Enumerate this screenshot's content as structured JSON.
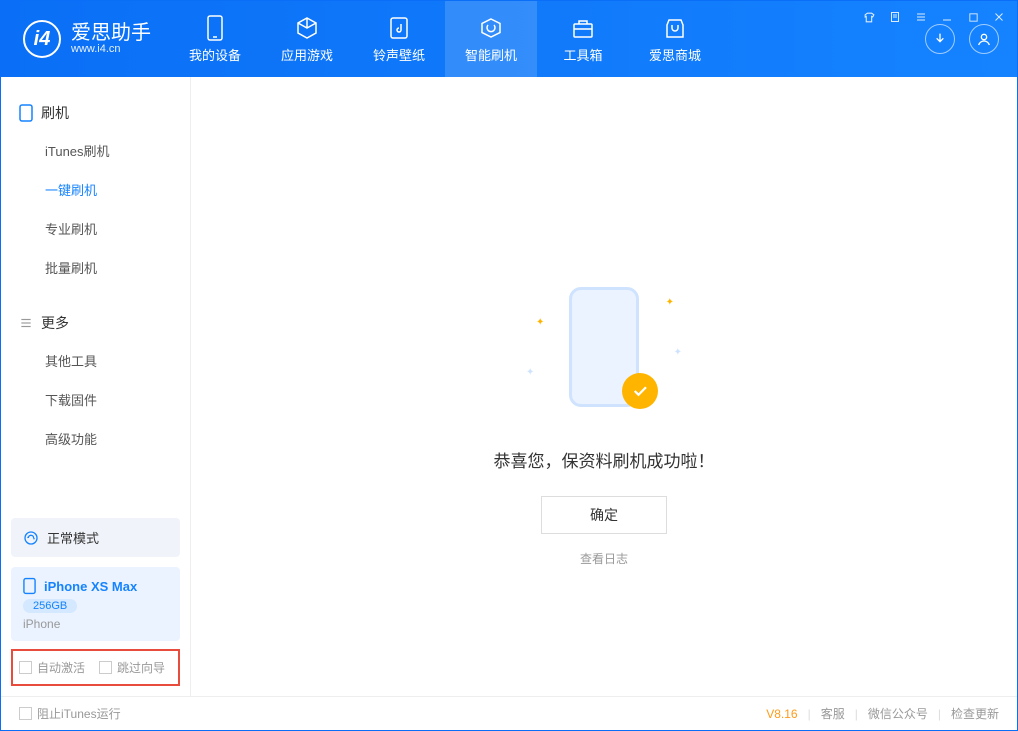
{
  "app": {
    "title": "爱思助手",
    "subtitle": "www.i4.cn"
  },
  "nav": [
    {
      "label": "我的设备",
      "icon": "device"
    },
    {
      "label": "应用游戏",
      "icon": "cube"
    },
    {
      "label": "铃声壁纸",
      "icon": "music"
    },
    {
      "label": "智能刷机",
      "icon": "refresh",
      "active": true
    },
    {
      "label": "工具箱",
      "icon": "toolbox"
    },
    {
      "label": "爱思商城",
      "icon": "store"
    }
  ],
  "sidebar": {
    "section1": {
      "title": "刷机",
      "items": [
        "iTunes刷机",
        "一键刷机",
        "专业刷机",
        "批量刷机"
      ],
      "activeIndex": 1
    },
    "section2": {
      "title": "更多",
      "items": [
        "其他工具",
        "下载固件",
        "高级功能"
      ]
    },
    "mode": "正常模式",
    "device": {
      "name": "iPhone XS Max",
      "storage": "256GB",
      "type": "iPhone"
    },
    "checkboxes": [
      "自动激活",
      "跳过向导"
    ]
  },
  "main": {
    "successMessage": "恭喜您，保资料刷机成功啦！",
    "okButton": "确定",
    "logLink": "查看日志"
  },
  "footer": {
    "blockItunes": "阻止iTunes运行",
    "version": "V8.16",
    "links": [
      "客服",
      "微信公众号",
      "检查更新"
    ]
  }
}
